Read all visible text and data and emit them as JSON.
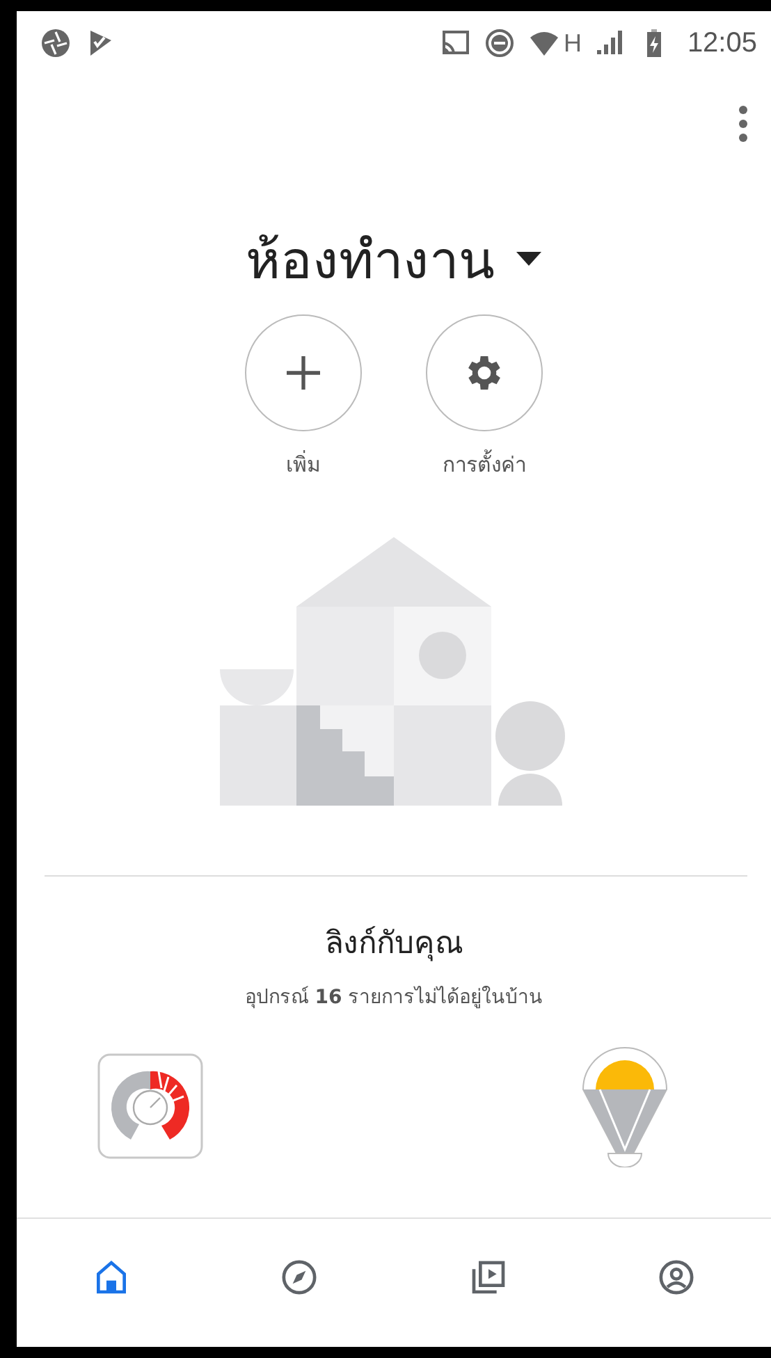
{
  "status_bar": {
    "network": "H",
    "time": "12:05"
  },
  "title": "ห้องทำงาน",
  "actions": [
    {
      "kind": "add",
      "label": "เพิ่ม"
    },
    {
      "kind": "settings",
      "label": "การตั้งค่า"
    }
  ],
  "linked": {
    "heading": "ลิงก์กับคุณ",
    "subtitle": "อุปกรณ์ **16** รายการไม่ได้อยู่ในบ้าน",
    "devices": [
      {
        "kind": "gauge"
      },
      {
        "kind": "bulb"
      }
    ]
  },
  "nav": [
    {
      "kind": "home",
      "selected": true
    },
    {
      "kind": "discover",
      "selected": false
    },
    {
      "kind": "media",
      "selected": false
    },
    {
      "kind": "account",
      "selected": false
    }
  ]
}
